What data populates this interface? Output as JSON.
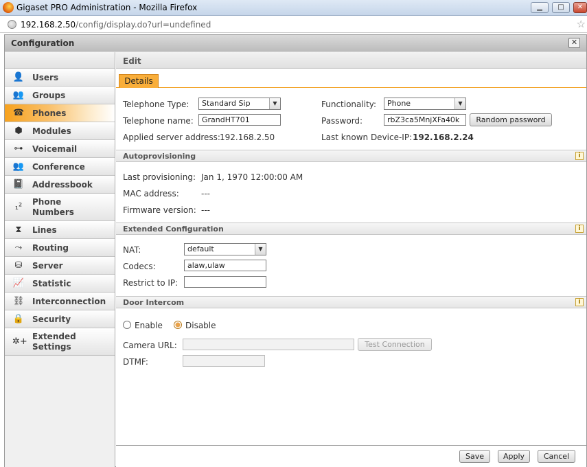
{
  "window": {
    "title": "Gigaset PRO Administration - Mozilla Firefox",
    "minimize": "▁",
    "maximize": "□",
    "close": "✕"
  },
  "address": {
    "host": "192.168.2.50",
    "path": "/config/display.do?url=undefined"
  },
  "dialog": {
    "title": "Configuration",
    "close": "✕"
  },
  "sidebar": {
    "items": [
      {
        "label": "Users",
        "icon": "user-icon",
        "glyph": "👤"
      },
      {
        "label": "Groups",
        "icon": "group-icon",
        "glyph": "👥"
      },
      {
        "label": "Phones",
        "icon": "phone-icon",
        "glyph": "☎"
      },
      {
        "label": "Modules",
        "icon": "module-icon",
        "glyph": "⬢"
      },
      {
        "label": "Voicemail",
        "icon": "voicemail-icon",
        "glyph": "⊶"
      },
      {
        "label": "Conference",
        "icon": "conference-icon",
        "glyph": "👥"
      },
      {
        "label": "Addressbook",
        "icon": "addressbook-icon",
        "glyph": "📓"
      },
      {
        "label": "Phone\nNumbers",
        "icon": "phone-numbers-icon",
        "glyph": "₁²"
      },
      {
        "label": "Lines",
        "icon": "lines-icon",
        "glyph": "⧗"
      },
      {
        "label": "Routing",
        "icon": "routing-icon",
        "glyph": "⤳"
      },
      {
        "label": "Server",
        "icon": "server-icon",
        "glyph": "⛁"
      },
      {
        "label": "Statistic",
        "icon": "statistic-icon",
        "glyph": "📈"
      },
      {
        "label": "Interconnection",
        "icon": "interconnection-icon",
        "glyph": "⛓"
      },
      {
        "label": "Security",
        "icon": "lock-icon",
        "glyph": "🔒"
      },
      {
        "label": "Extended\nSettings",
        "icon": "extended-settings-icon",
        "glyph": "✲+"
      }
    ],
    "active": "Phones"
  },
  "edit": {
    "header": "Edit",
    "tab_details": "Details"
  },
  "details": {
    "telephone_type_label": "Telephone Type:",
    "telephone_type_value": "Standard Sip",
    "functionality_label": "Functionality:",
    "functionality_value": "Phone",
    "telephone_name_label": "Telephone name:",
    "telephone_name_value": "GrandHT701",
    "password_label": "Password:",
    "password_value": "rbZ3ca5MnjXFa40k",
    "random_password_button": "Random password",
    "applied_server_label": "Applied server address:",
    "applied_server_value": "192.168.2.50",
    "last_device_ip_label": "Last known Device-IP:",
    "last_device_ip_value": "192.168.2.24"
  },
  "autoprovisioning": {
    "title": "Autoprovisioning",
    "last_provisioning_label": "Last provisioning:",
    "last_provisioning_value": "Jan 1, 1970 12:00:00 AM",
    "mac_label": "MAC address:",
    "mac_value": "---",
    "firmware_label": "Firmware version:",
    "firmware_value": "---"
  },
  "extended": {
    "title": "Extended Configuration",
    "nat_label": "NAT:",
    "nat_value": "default",
    "codecs_label": "Codecs:",
    "codecs_value": "alaw,ulaw",
    "restrict_label": "Restrict to IP:",
    "restrict_value": ""
  },
  "door_intercom": {
    "title": "Door Intercom",
    "enable_label": "Enable",
    "disable_label": "Disable",
    "selected": "Disable",
    "camera_url_label": "Camera URL:",
    "camera_url_value": "",
    "test_connection_button": "Test Connection",
    "dtmf_label": "DTMF:",
    "dtmf_value": ""
  },
  "footer": {
    "save": "Save",
    "apply": "Apply",
    "cancel": "Cancel"
  },
  "info_icon": "i"
}
